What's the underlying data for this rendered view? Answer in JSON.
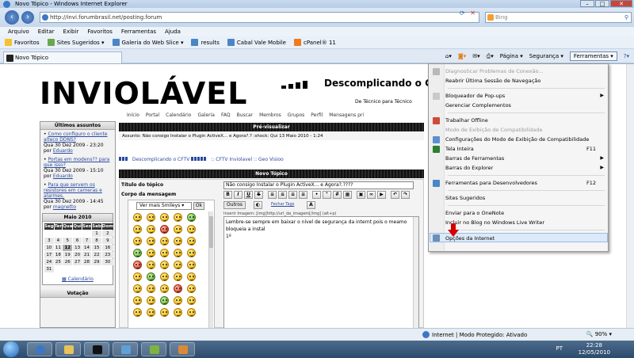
{
  "window": {
    "title": "Novo Tópico - Windows Internet Explorer"
  },
  "address": {
    "url": "http://invi.forumbrasil.net/posting.forum",
    "search_placeholder": "Bing"
  },
  "menubar": [
    "Arquivo",
    "Editar",
    "Exibir",
    "Favoritos",
    "Ferramentas",
    "Ajuda"
  ],
  "favorites": {
    "label": "Favoritos",
    "items": [
      "Sites Sugeridos ▾",
      "Galeria do Web Slice ▾",
      "results",
      "Cabal Vale Mobile",
      "cPanel® 11"
    ]
  },
  "tab": {
    "label": "Novo Tópico"
  },
  "commandbar": {
    "page": "Página ▾",
    "security": "Segurança ▾",
    "tools": "Ferramentas ▾"
  },
  "site": {
    "logo": "INVIOLÁVEL",
    "title": "Descomplicando o C",
    "subtitle": "De Técnico para Técnico",
    "nav": [
      "Início",
      "Portal",
      "Calendário",
      "Galeria",
      "FAQ",
      "Buscar",
      "Membros",
      "Grupos",
      "Perfil",
      "Mensagens pri"
    ]
  },
  "sidebar": {
    "recent_header": "Últimos assuntos",
    "posts": [
      {
        "title": "Como configuro o cliente alteco DDNS?",
        "date": "Qua 30 Dez 2009 - 23:20",
        "by": "por",
        "author": "Eduardo"
      },
      {
        "title": "Portas em modens?? para que isso?",
        "date": "Qua 30 Dez 2009 - 15:10",
        "by": "por",
        "author": "Eduardo"
      },
      {
        "title": "Para que servem os resistores em cameras e alarmes.",
        "date": "Qua 30 Dez 2009 - 14:45",
        "by": "por",
        "author": "magnetto"
      }
    ],
    "calendar": {
      "header": "Maio 2010",
      "days": [
        "Seg",
        "Ter",
        "Qua",
        "Qui",
        "Sex",
        "Sab",
        "Dom"
      ],
      "dates": [
        "",
        "",
        "",
        "",
        "",
        "1",
        "2",
        "3",
        "4",
        "5",
        "6",
        "7",
        "8",
        "9",
        "10",
        "11",
        "12",
        "13",
        "14",
        "15",
        "16",
        "17",
        "18",
        "19",
        "20",
        "21",
        "22",
        "23",
        "24",
        "25",
        "26",
        "27",
        "28",
        "29",
        "30",
        "31"
      ],
      "today": "12",
      "link": "Calendário"
    },
    "vote_header": "Votação"
  },
  "main": {
    "preview_header": "Pré-visualizar",
    "preview_row": "Assunto: Não consigo Instalar o Plugin ActiveX... e Agora?.? :shock:  Qui 13 Maio 2010 - 1:24",
    "breadcrumb": [
      "Descomplicando o CFTV",
      "::",
      "CFTV Inviolavel",
      "::",
      "Geo Visioo"
    ],
    "newtopic_header": "Novo Tópico",
    "title_label": "Título do tópico",
    "title_value": "Não consigo Instalar o Plugin ActiveX... e Agora?.????",
    "body_label": "Corpo da mensagem",
    "smiley_select": "Ver mais Smileys",
    "smiley_ok": "Ok",
    "outros": "Outros",
    "fechar_tags": "Fechar Tags",
    "insert_image": "Inserir Imagem: [img]http://url_da_imagem[/img] (alt+p)",
    "editor_line1": "Lembre-se sempre em baixar o nível de segurança da internt pois o meamo bloqueia a instal",
    "editor_line2": "1º"
  },
  "tools_menu": [
    {
      "label": "Diagnosticar Problemas de Conexão...",
      "disabled": true
    },
    {
      "label": "Reabrir Última Sessão de Navegação"
    },
    {
      "sep": true
    },
    {
      "label": "Bloqueador de Pop-ups",
      "submenu": true
    },
    {
      "label": "Gerenciar Complementos"
    },
    {
      "sep": true
    },
    {
      "label": "Trabalhar Offline"
    },
    {
      "label": "Modo de Exibição de Compatibilidade",
      "disabled": true
    },
    {
      "label": "Configurações do Modo de Exibição de Compatibilidade"
    },
    {
      "label": "Tela Inteira",
      "key": "F11"
    },
    {
      "label": "Barras de Ferramentas",
      "submenu": true
    },
    {
      "label": "Barras do Explorer",
      "submenu": true
    },
    {
      "sep": true
    },
    {
      "label": "Ferramentas para Desenvolvedores",
      "key": "F12"
    },
    {
      "sep": true
    },
    {
      "label": "Sites Sugeridos"
    },
    {
      "sep": true
    },
    {
      "label": "Enviar para o OneNote"
    },
    {
      "label": "Incluir no Blog no Windows Live Writer"
    },
    {
      "sep": true
    },
    {
      "label": "Opções da Internet",
      "highlighted": true
    }
  ],
  "statusbar": {
    "zone": "Internet | Modo Protegido: Ativado",
    "zoom": "90%"
  },
  "taskbar": {
    "lang": "PT",
    "time": "22:28",
    "date": "12/05/2010"
  }
}
